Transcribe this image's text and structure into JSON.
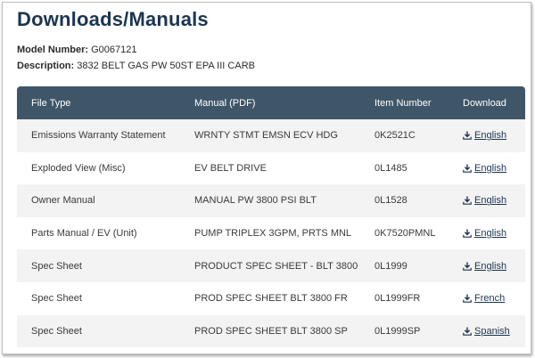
{
  "page": {
    "title": "Downloads/Manuals",
    "model_label": "Model Number:",
    "model_value": "G0067121",
    "description_label": "Description:",
    "description_value": "3832 BELT GAS PW 50ST EPA III CARB"
  },
  "table": {
    "headers": {
      "file_type": "File Type",
      "manual": "Manual (PDF)",
      "item_number": "Item Number",
      "download": "Download"
    },
    "rows": [
      {
        "file_type": "Emissions Warranty Statement",
        "manual": "WRNTY STMT EMSN ECV HDG",
        "item_number": "0K2521C",
        "download": "English"
      },
      {
        "file_type": "Exploded View (Misc)",
        "manual": "EV BELT DRIVE",
        "item_number": "0L1485",
        "download": "English"
      },
      {
        "file_type": "Owner Manual",
        "manual": "MANUAL PW 3800 PSI BLT",
        "item_number": "0L1528",
        "download": "English"
      },
      {
        "file_type": "Parts Manual / EV (Unit)",
        "manual": "PUMP TRIPLEX 3GPM, PRTS MNL",
        "item_number": "0K7520PMNL",
        "download": "English"
      },
      {
        "file_type": "Spec Sheet",
        "manual": "PRODUCT SPEC SHEET - BLT 3800",
        "item_number": "0L1999",
        "download": "English"
      },
      {
        "file_type": "Spec Sheet",
        "manual": "PROD SPEC SHEET BLT 3800 FR",
        "item_number": "0L1999FR",
        "download": "French"
      },
      {
        "file_type": "Spec Sheet",
        "manual": "PROD SPEC SHEET BLT 3800 SP",
        "item_number": "0L1999SP",
        "download": "Spanish"
      }
    ]
  },
  "icons": {
    "download": "download-icon"
  },
  "colors": {
    "title": "#1c3550",
    "header_bg": "#3f5668",
    "stripe": "#f3f3f3",
    "link": "#1c3550"
  }
}
